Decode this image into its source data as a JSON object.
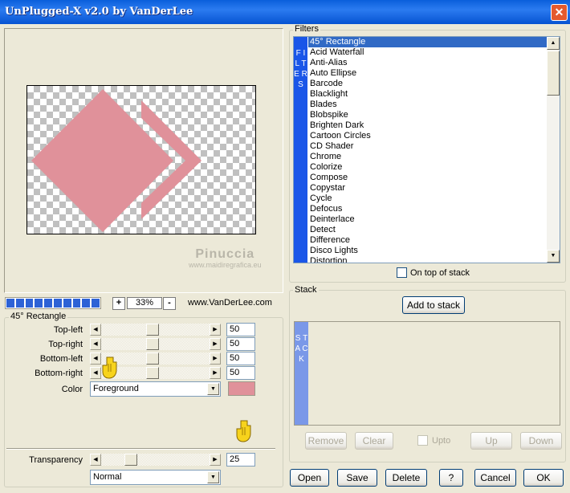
{
  "window": {
    "title": "UnPlugged-X v2.0 by VanDerLee",
    "close_glyph": "✕"
  },
  "preview": {
    "watermark_line1": "Pinuccia",
    "watermark_line2": "www.maidiregrafica.eu",
    "shape_color": "#E0919A"
  },
  "zoom": {
    "minus": "-",
    "plus": "+",
    "value": "33%",
    "progress_segments": 10,
    "site": "www.VanDerLee.com"
  },
  "params": {
    "group_title": "45° Rectangle",
    "rows": [
      {
        "label": "Top-left",
        "value": "50"
      },
      {
        "label": "Top-right",
        "value": "50"
      },
      {
        "label": "Bottom-left",
        "value": "50"
      },
      {
        "label": "Bottom-right",
        "value": "50"
      }
    ],
    "color_label": "Color",
    "color_value": "Foreground",
    "color_swatch": "#E0919A",
    "transparency_label": "Transparency",
    "transparency_value": "25",
    "blend_mode": "Normal"
  },
  "filters": {
    "group_title": "Filters",
    "tab_label": "F I L T E R S",
    "items": [
      "45° Rectangle",
      "Acid Waterfall",
      "Anti-Alias",
      "Auto Ellipse",
      "Barcode",
      "Blacklight",
      "Blades",
      "Blobspike",
      "Brighten Dark",
      "Cartoon Circles",
      "CD Shader",
      "Chrome",
      "Colorize",
      "Compose",
      "Copystar",
      "Cycle",
      "Defocus",
      "Deinterlace",
      "Detect",
      "Difference",
      "Disco Lights",
      "Distortion"
    ],
    "selected_index": 0,
    "on_top_label": "On top of stack"
  },
  "stack": {
    "group_title": "Stack",
    "add_label": "Add to stack",
    "tab_label": "S T A C K",
    "remove_label": "Remove",
    "clear_label": "Clear",
    "upto_label": "Upto",
    "up_label": "Up",
    "down_label": "Down"
  },
  "footer": {
    "open": "Open",
    "save": "Save",
    "delete": "Delete",
    "help": "?",
    "cancel": "Cancel",
    "ok": "OK"
  }
}
